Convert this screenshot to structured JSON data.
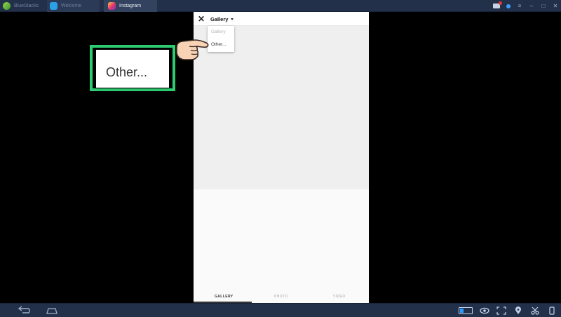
{
  "topbar": {
    "tabs": [
      {
        "label": "BlueStacks"
      },
      {
        "label": "Welcome"
      },
      {
        "label": "Instagram"
      }
    ]
  },
  "instagram": {
    "source_selector": "Gallery",
    "dropdown": {
      "items": [
        "Gallery",
        "Other..."
      ]
    },
    "bottom_tabs": [
      "GALLERY",
      "PHOTO",
      "VIDEO"
    ]
  },
  "callout": {
    "text": "Other..."
  },
  "colors": {
    "chrome": "#23304a",
    "callout_border": "#2ecc71"
  }
}
